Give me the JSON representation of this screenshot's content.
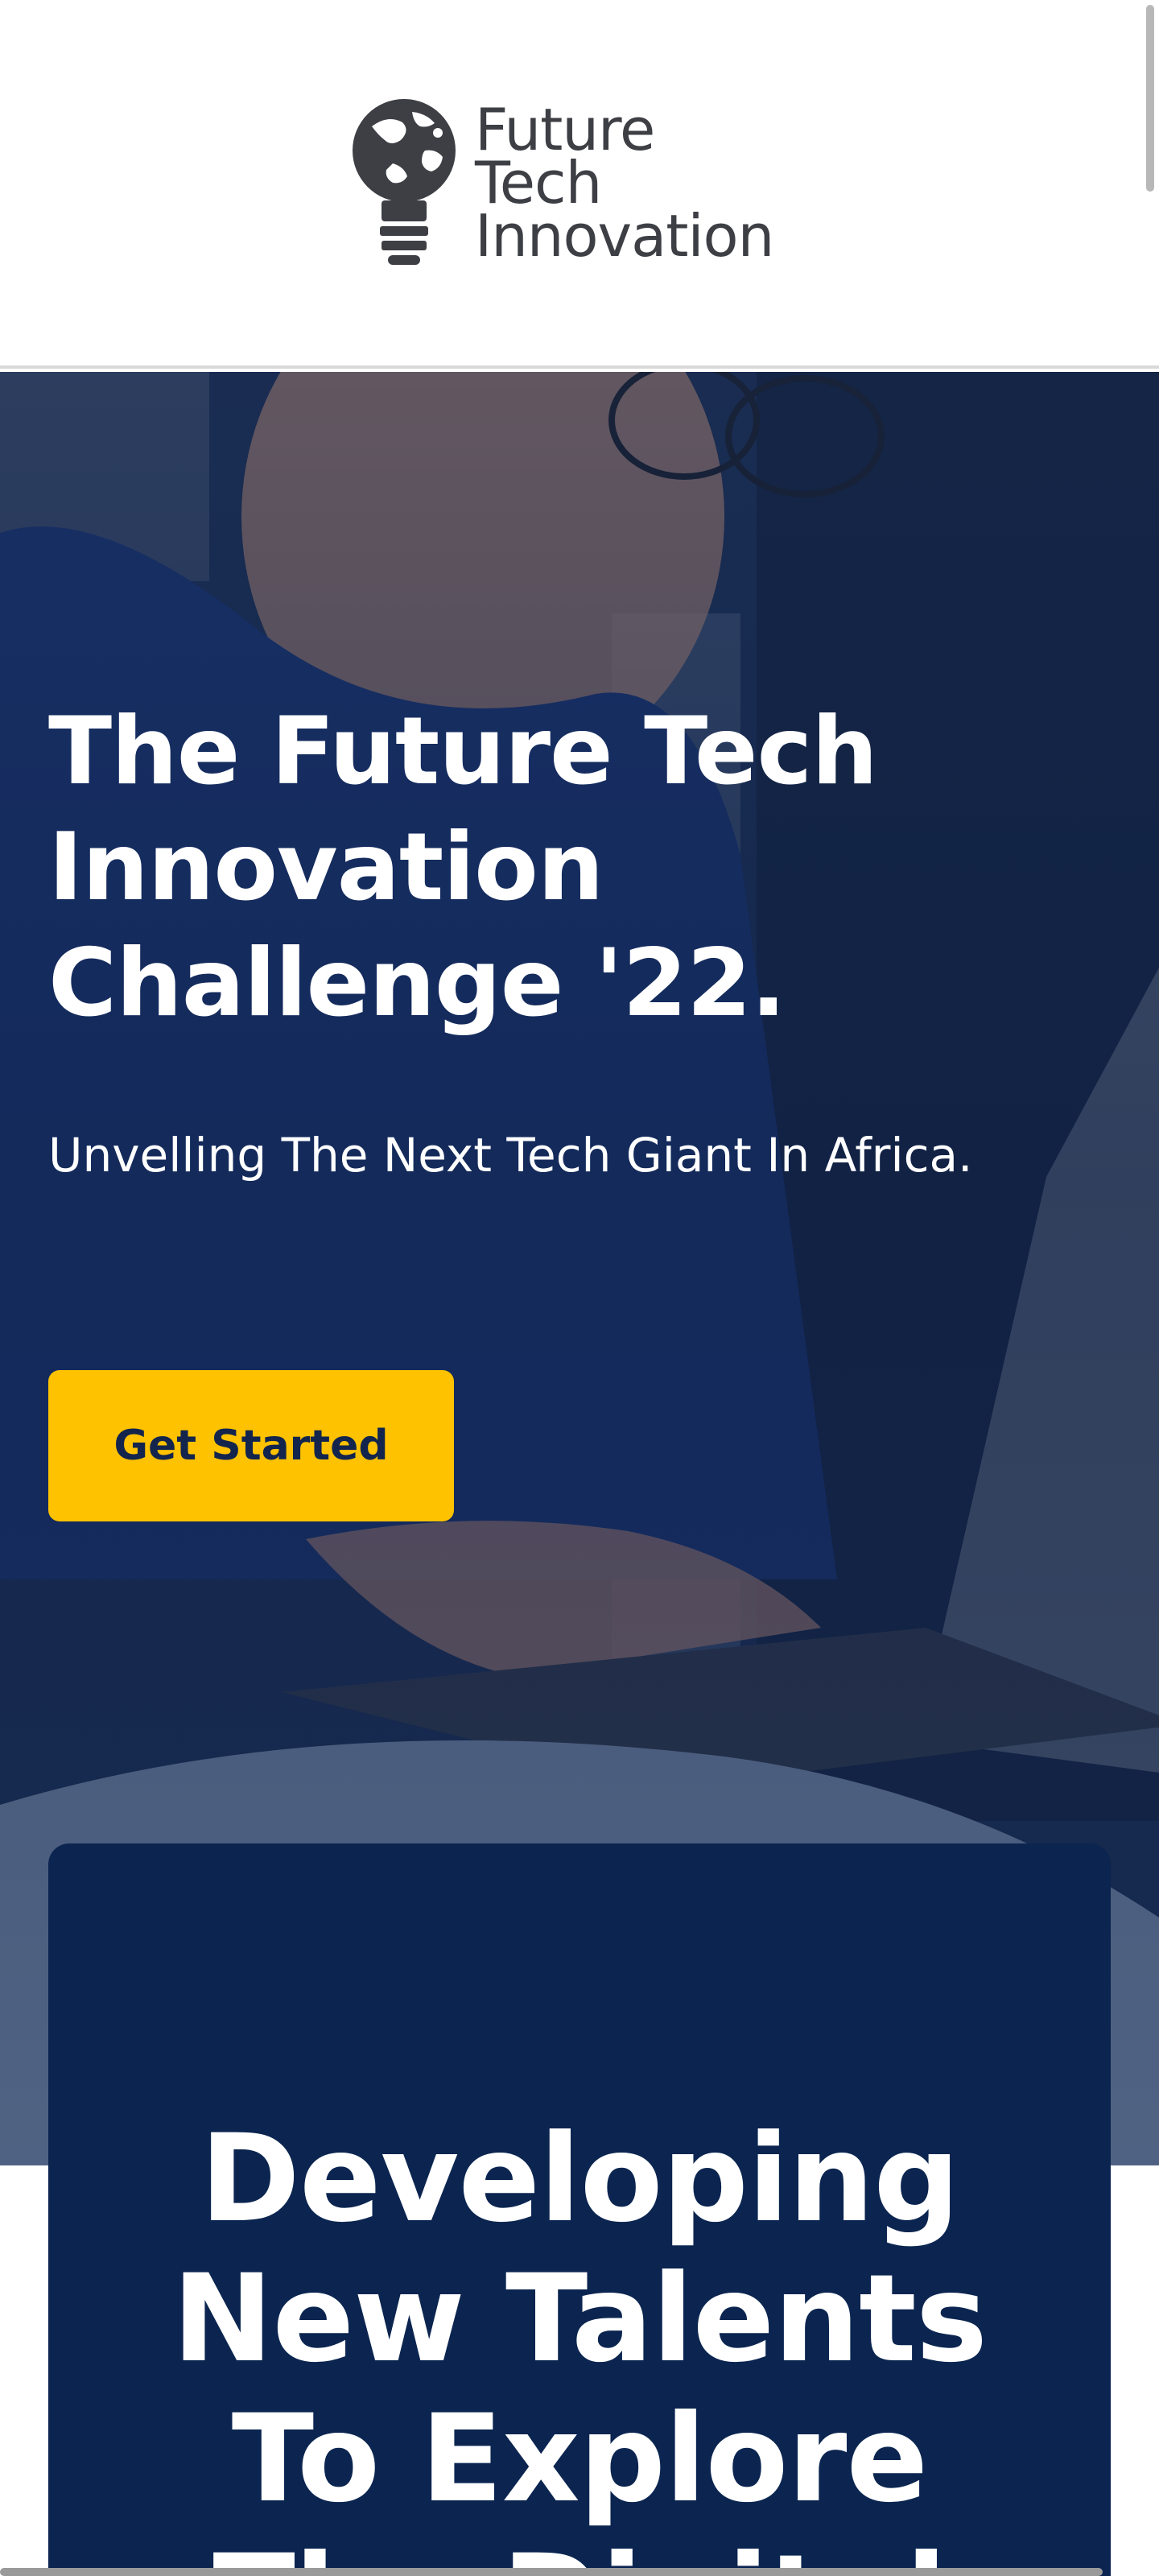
{
  "header": {
    "logo": {
      "lines": [
        "Future",
        "Tech",
        "Innovation"
      ],
      "icon": "lightbulb-globe-icon",
      "color": "#3d3f45"
    }
  },
  "hero": {
    "title_lines": [
      "The Future Tech",
      "Innovation",
      "Challenge '22."
    ],
    "subtitle": "Unvelling The Next Tech Giant In Africa.",
    "cta_label": "Get Started",
    "cta_color": "#fec200",
    "overlay_color": "#0a1c42"
  },
  "feature": {
    "heading_lines": [
      "Developing",
      "New Talents",
      "To Explore",
      "The Digital"
    ],
    "background": "#0b2550"
  }
}
